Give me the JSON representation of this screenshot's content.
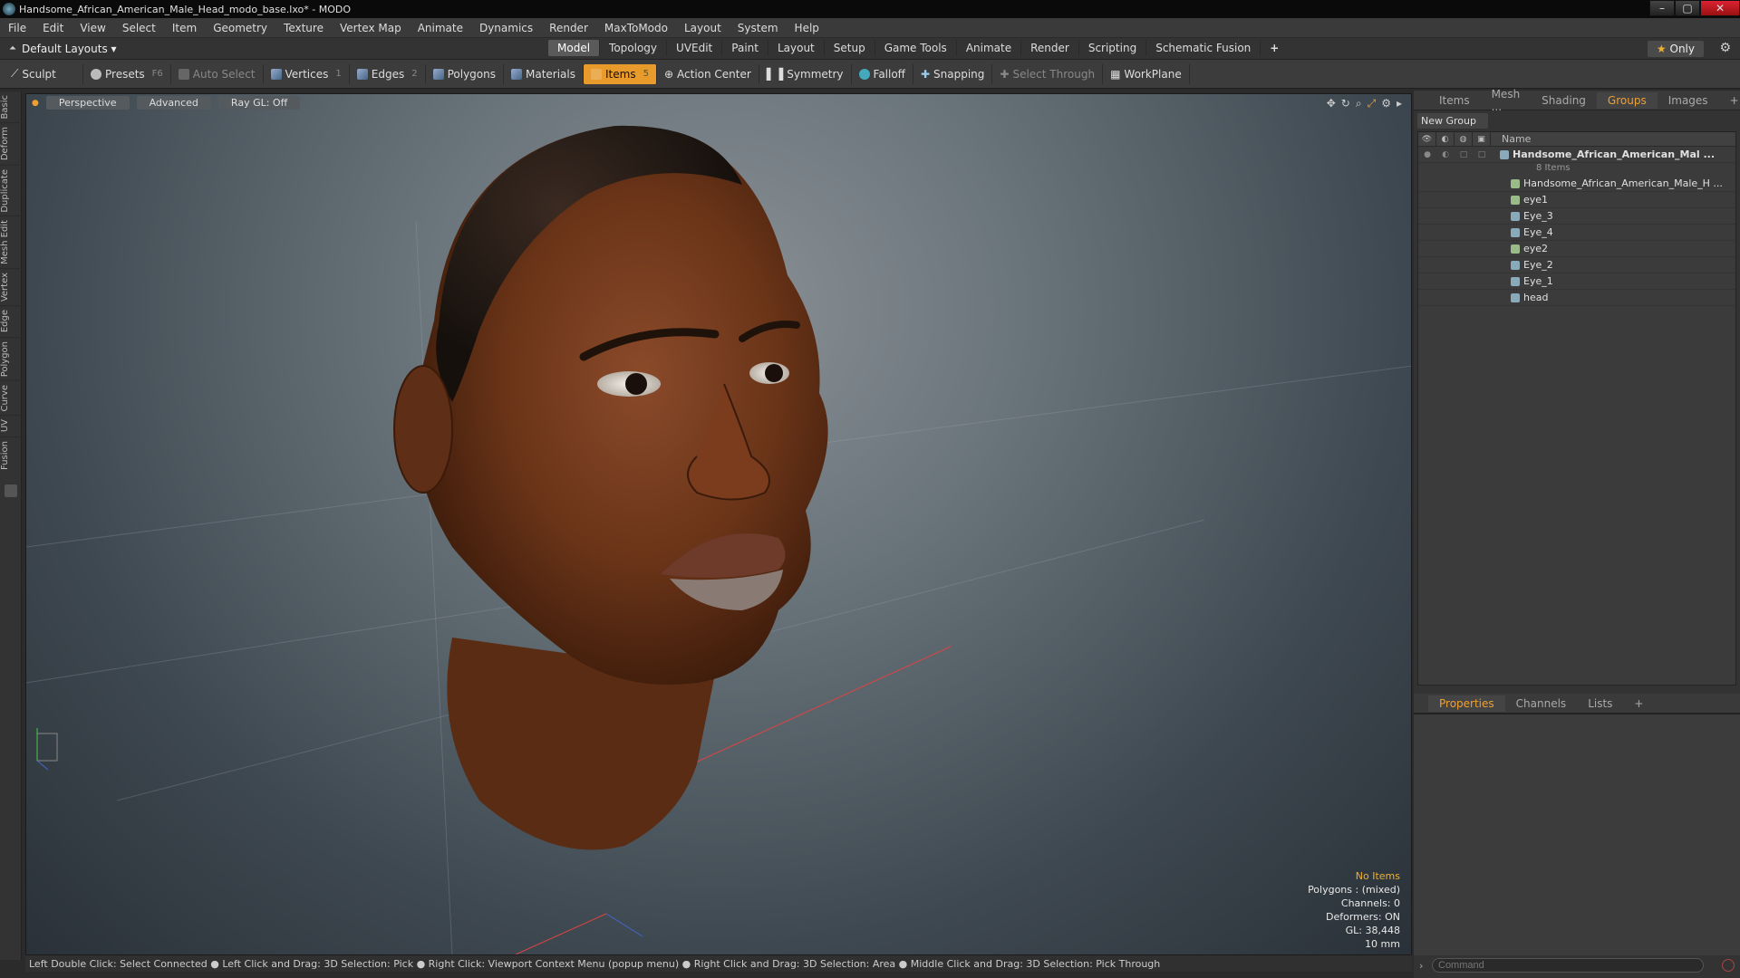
{
  "window": {
    "title": "Handsome_African_American_Male_Head_modo_base.lxo* - MODO"
  },
  "menu": [
    "File",
    "Edit",
    "View",
    "Select",
    "Item",
    "Geometry",
    "Texture",
    "Vertex Map",
    "Animate",
    "Dynamics",
    "Render",
    "MaxToModo",
    "Layout",
    "System",
    "Help"
  ],
  "layouts": {
    "label": "Default Layouts",
    "only": "Only"
  },
  "mode_tabs": [
    "Model",
    "Topology",
    "UVEdit",
    "Paint",
    "Layout",
    "Setup",
    "Game Tools",
    "Animate",
    "Render",
    "Scripting",
    "Schematic Fusion"
  ],
  "mode_active": "Model",
  "toolbar": {
    "sculpt": "Sculpt",
    "presets": "Presets",
    "presets_key": "F6",
    "auto_select": "Auto Select",
    "vertices": "Vertices",
    "vertices_key": "1",
    "edges": "Edges",
    "edges_key": "2",
    "polygons": "Polygons",
    "materials": "Materials",
    "items": "Items",
    "items_key": "5",
    "action_center": "Action Center",
    "symmetry": "Symmetry",
    "falloff": "Falloff",
    "snapping": "Snapping",
    "select_through": "Select Through",
    "workplane": "WorkPlane"
  },
  "left_tabs": [
    "Basic",
    "Deform",
    "Duplicate",
    "Mesh Edit",
    "Vertex",
    "Edge",
    "Polygon",
    "Curve",
    "UV",
    "Fusion"
  ],
  "viewport": {
    "perspective": "Perspective",
    "advanced": "Advanced",
    "raygl": "Ray GL: Off",
    "stats": {
      "no_items": "No Items",
      "polygons": "Polygons : (mixed)",
      "channels": "Channels: 0",
      "deformers": "Deformers: ON",
      "gl": "GL: 38,448",
      "scale": "10 mm"
    }
  },
  "statusbar": "Left Double Click: Select Connected ● Left Click and Drag: 3D Selection: Pick ● Right Click: Viewport Context Menu (popup menu) ● Right Click and Drag: 3D Selection: Area ● Middle Click and Drag: 3D Selection: Pick Through",
  "right_panel": {
    "tabs": [
      "Items",
      "Mesh ...",
      "Shading",
      "Groups",
      "Images"
    ],
    "active_tab": "Groups",
    "new_group": "New Group",
    "name_header": "Name",
    "group": {
      "name": "Handsome_African_American_Mal ...",
      "count": "8 Items",
      "children": [
        "Handsome_African_American_Male_H ...",
        "eye1",
        "Eye_3",
        "Eye_4",
        "eye2",
        "Eye_2",
        "Eye_1",
        "head"
      ]
    },
    "bottom_tabs": [
      "Properties",
      "Channels",
      "Lists"
    ],
    "bottom_active": "Properties",
    "command_placeholder": "Command"
  }
}
